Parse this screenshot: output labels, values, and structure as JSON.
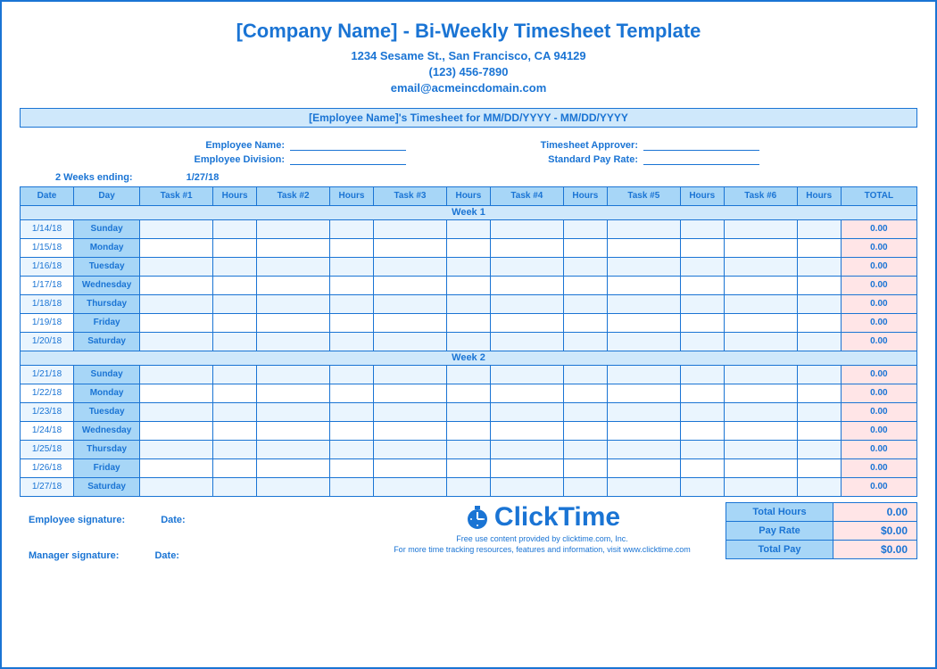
{
  "title": "[Company Name] - Bi-Weekly Timesheet Template",
  "address": "1234 Sesame St.,  San Francisco, CA 94129",
  "phone": "(123) 456-7890",
  "email": "email@acmeincdomain.com",
  "subheader": "[Employee Name]'s Timesheet for MM/DD/YYYY - MM/DD/YYYY",
  "fields": {
    "left": [
      {
        "label": "Employee Name:"
      },
      {
        "label": "Employee Division:"
      }
    ],
    "right": [
      {
        "label": "Timesheet Approver:"
      },
      {
        "label": "Standard Pay Rate:"
      }
    ]
  },
  "period_label": "2 Weeks ending:",
  "period_value": "1/27/18",
  "columns": [
    "Date",
    "Day",
    "Task #1",
    "Hours",
    "Task #2",
    "Hours",
    "Task #3",
    "Hours",
    "Task #4",
    "Hours",
    "Task #5",
    "Hours",
    "Task #6",
    "Hours",
    "TOTAL"
  ],
  "weeks": [
    {
      "label": "Week 1",
      "rows": [
        {
          "date": "1/14/18",
          "day": "Sunday",
          "total": "0.00"
        },
        {
          "date": "1/15/18",
          "day": "Monday",
          "total": "0.00"
        },
        {
          "date": "1/16/18",
          "day": "Tuesday",
          "total": "0.00"
        },
        {
          "date": "1/17/18",
          "day": "Wednesday",
          "total": "0.00"
        },
        {
          "date": "1/18/18",
          "day": "Thursday",
          "total": "0.00"
        },
        {
          "date": "1/19/18",
          "day": "Friday",
          "total": "0.00"
        },
        {
          "date": "1/20/18",
          "day": "Saturday",
          "total": "0.00"
        }
      ]
    },
    {
      "label": "Week 2",
      "rows": [
        {
          "date": "1/21/18",
          "day": "Sunday",
          "total": "0.00"
        },
        {
          "date": "1/22/18",
          "day": "Monday",
          "total": "0.00"
        },
        {
          "date": "1/23/18",
          "day": "Tuesday",
          "total": "0.00"
        },
        {
          "date": "1/24/18",
          "day": "Wednesday",
          "total": "0.00"
        },
        {
          "date": "1/25/18",
          "day": "Thursday",
          "total": "0.00"
        },
        {
          "date": "1/26/18",
          "day": "Friday",
          "total": "0.00"
        },
        {
          "date": "1/27/18",
          "day": "Saturday",
          "total": "0.00"
        }
      ]
    }
  ],
  "summary": [
    {
      "label": "Total Hours",
      "value": "0.00"
    },
    {
      "label": "Pay Rate",
      "value": "$0.00"
    },
    {
      "label": "Total Pay",
      "value": "$0.00"
    }
  ],
  "signatures": {
    "employee": "Employee signature:",
    "manager": "Manager signature:",
    "date": "Date:"
  },
  "brand": {
    "name": "ClickTime",
    "line1": "Free use content provided by clicktime.com, Inc.",
    "line2": "For more time tracking resources, features and information, visit www.clicktime.com"
  }
}
